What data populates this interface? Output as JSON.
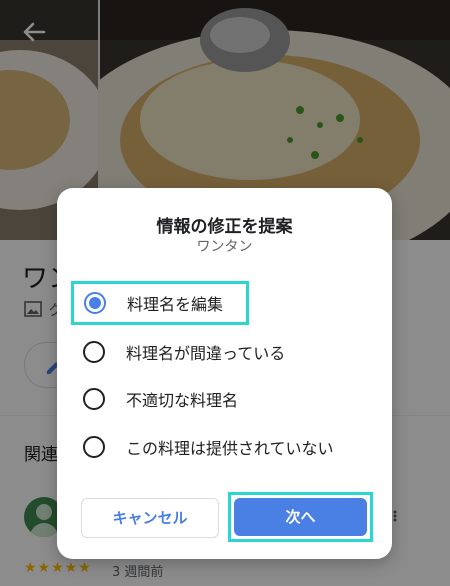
{
  "background": {
    "place_title": "ワン",
    "meta_text": "ク",
    "related_heading": "関連",
    "rating_stars": "★★★★★",
    "review_time": "3 週間前"
  },
  "dialog": {
    "title": "情報の修正を提案",
    "subtitle": "ワンタン",
    "options": [
      {
        "label": "料理名を編集",
        "selected": true
      },
      {
        "label": "料理名が間違っている",
        "selected": false
      },
      {
        "label": "不適切な料理名",
        "selected": false
      },
      {
        "label": "この料理は提供されていない",
        "selected": false
      }
    ],
    "cancel_label": "キャンセル",
    "next_label": "次へ"
  },
  "colors": {
    "accent": "#4a7fe4",
    "highlight": "#2ad6d0"
  }
}
